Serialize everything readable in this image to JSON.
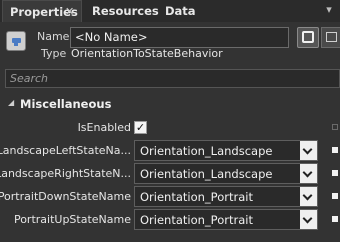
{
  "tabs": [
    {
      "label": "Properties",
      "close": "✕"
    },
    {
      "label": "Resources"
    },
    {
      "label": "Data"
    }
  ],
  "pin_glyph": "📌",
  "element": {
    "name_label": "Name",
    "name_value": "<No Name>",
    "type_label": "Type",
    "type_value": "OrientationToStateBehavior"
  },
  "search": {
    "placeholder": "Search"
  },
  "category": {
    "label": "Miscellaneous",
    "arrow": "◢"
  },
  "properties": {
    "is_enabled": {
      "label": "IsEnabled",
      "checked": true,
      "check_glyph": "✓"
    },
    "landscape_left": {
      "label": "LandscapeLeftStateNa...",
      "value": "Orientation_Landscape"
    },
    "landscape_right": {
      "label": "LandscapeRightStateN...",
      "value": "Orientation_Landscape"
    },
    "portrait_down": {
      "label": "PortraitDownStateName",
      "value": "Orientation_Portrait"
    },
    "portrait_up": {
      "label": "PortraitUpStateName",
      "value": "Orientation_Portrait"
    }
  }
}
